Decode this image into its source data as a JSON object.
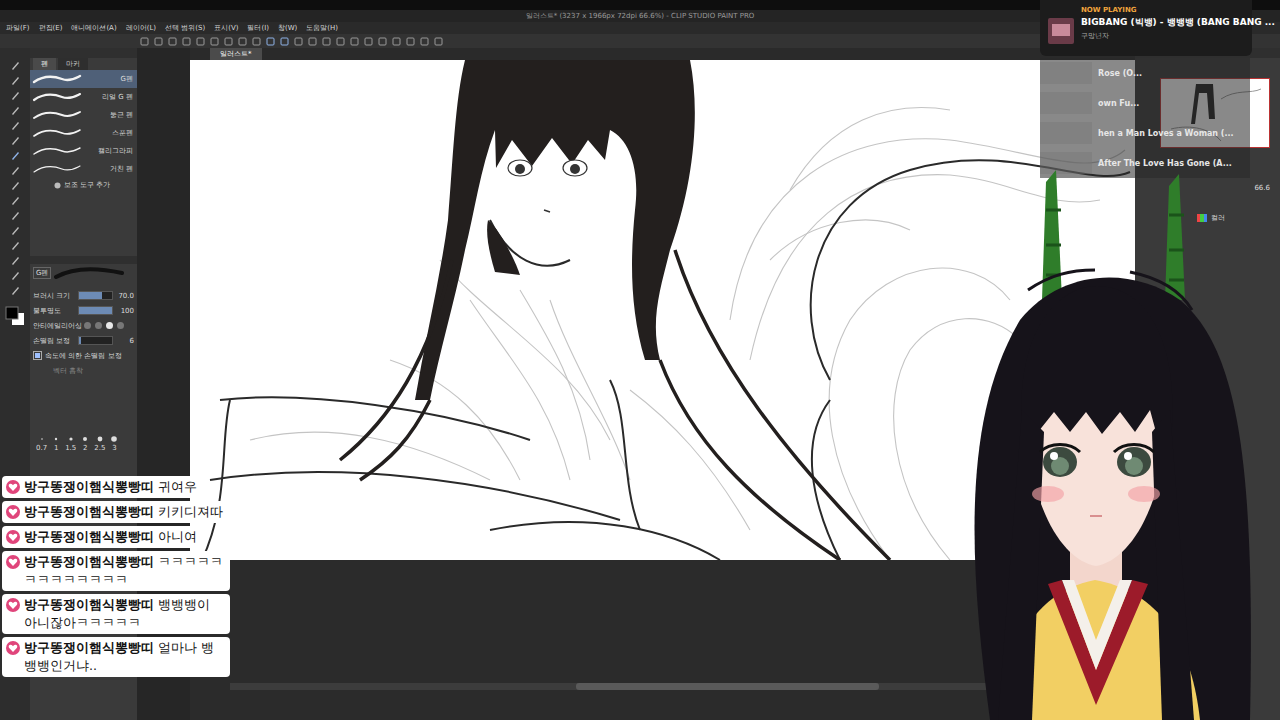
{
  "window": {
    "title": "일러스트* (3237 x 1966px 72dpi 66.6%) - CLIP STUDIO PAINT PRO"
  },
  "menu": [
    "파일(F)",
    "편집(E)",
    "애니메이션(A)",
    "레이어(L)",
    "선택 범위(S)",
    "표시(V)",
    "필터(I)",
    "창(W)",
    "도움말(H)"
  ],
  "canvas_tabs": [
    {
      "label": "일러스트*",
      "selected": true
    }
  ],
  "subtool": {
    "tabs": [
      {
        "label": "펜",
        "selected": true
      },
      {
        "label": "마커",
        "selected": false
      }
    ],
    "items": [
      {
        "label": "G펜",
        "selected": true
      },
      {
        "label": "리얼 G 펜",
        "selected": false
      },
      {
        "label": "둥근 펜",
        "selected": false
      },
      {
        "label": "스푼펜",
        "selected": false
      },
      {
        "label": "캘리그라피",
        "selected": false
      },
      {
        "label": "거친 펜",
        "selected": false
      }
    ],
    "add": "보조 도구 추가"
  },
  "tool_property": {
    "name": "G펜",
    "rows": [
      {
        "kind": "slider",
        "label": "브러시 크기",
        "value": "70.0",
        "level": 0.7
      },
      {
        "kind": "slider",
        "label": "불투명도",
        "value": "100",
        "level": 1
      },
      {
        "kind": "choice",
        "label": "안티에일리어싱",
        "options": [
          {
            "selected": false
          },
          {
            "selected": false
          },
          {
            "selected": true
          },
          {
            "selected": false
          }
        ]
      },
      {
        "kind": "slider",
        "label": "손떨림 보정",
        "value": "6",
        "level": 0.06
      },
      {
        "kind": "checkbox",
        "label": "속도에 의한 손떨림 보정",
        "checked": true
      },
      {
        "kind": "text",
        "label": "벡터 흡착",
        "disabled": true
      }
    ]
  },
  "brush_sizes": [
    "0.7",
    "1",
    "1.5",
    "2",
    "2.5",
    "3"
  ],
  "now_playing": {
    "header": "NOW PLAYING",
    "title": "BIGBANG (빅뱅) - 뱅뱅뱅 (BANG BANG ...",
    "artist": "구망년자"
  },
  "playlist": [
    "Rose (O...",
    "own Fu...",
    "hen a Man Loves a Woman (...",
    "After The Love Has Gone (A..."
  ],
  "navigator": {
    "zoom": "66.6"
  },
  "layer": {
    "mode": "컬러"
  },
  "chat": {
    "user": "방구똥쟁이햄식뽕빵띠",
    "messages": [
      "귀여우",
      "키키디져따",
      "아니여",
      "ㅋㅋㅋㅋㅋㅋㅋㅋㅋㅋㅋㅋㅋ",
      "뱅뱅뱅이 아니잖아ㅋㅋㅋㅋㅋ",
      "얼마나 뱅뱅뱅인거냐.."
    ]
  }
}
